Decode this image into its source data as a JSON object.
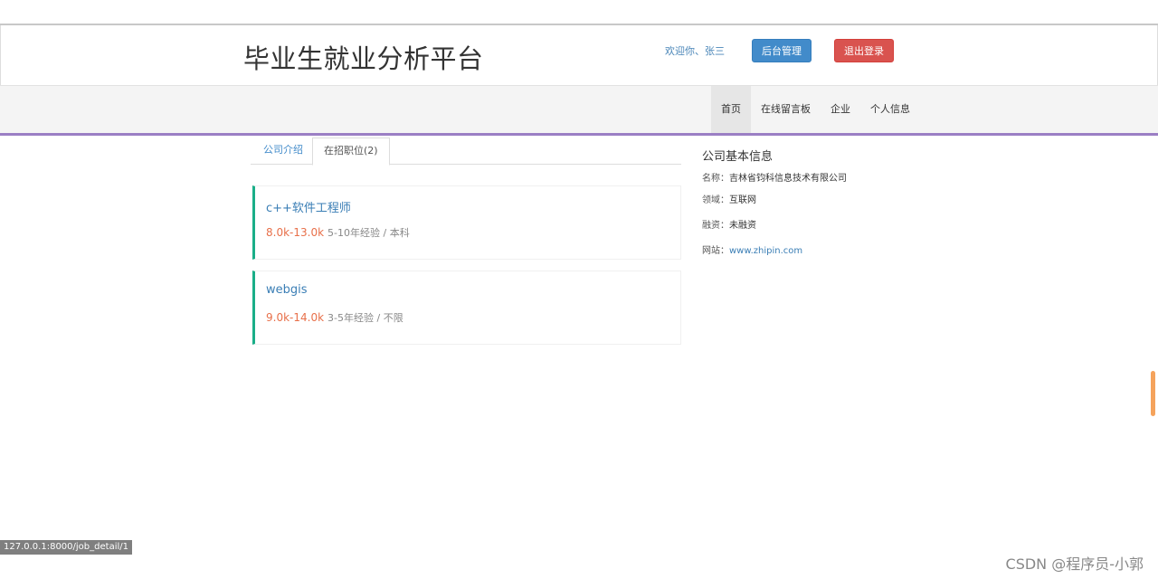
{
  "header": {
    "site_title": "毕业生就业分析平台",
    "welcome": "欢迎你、张三",
    "admin_button": "后台管理",
    "logout_button": "退出登录"
  },
  "nav": {
    "items": [
      "首页",
      "在线留言板",
      "企业",
      "个人信息"
    ],
    "active": "首页"
  },
  "tabs": {
    "intro": "公司介绍",
    "jobs": "在招职位(2)",
    "active": "在招职位(2)"
  },
  "jobs": [
    {
      "title": "c++软件工程师",
      "salary": "8.0k-13.0k",
      "requirements": "5-10年经验 / 本科"
    },
    {
      "title": "webgis",
      "salary": "9.0k-14.0k",
      "requirements": "3-5年经验 / 不限"
    }
  ],
  "company_info": {
    "heading": "公司基本信息",
    "name_label": "名称：",
    "name": "吉林省钧科信息技术有限公司",
    "field_label": "领域：",
    "field": "互联网",
    "funding_label": "融资：",
    "funding": "未融资",
    "site_label": "网站：",
    "site": "www.zhipin.com"
  },
  "status_bar": {
    "url": "127.0.0.1:8000/job_detail/1"
  },
  "watermark": "CSDN @程序员-小郭",
  "colors": {
    "accent_purple": "#9b7fc4",
    "primary_blue": "#428bca",
    "danger_red": "#d9534f",
    "job_border_green": "#1aae88",
    "salary_orange": "#e8704a"
  }
}
